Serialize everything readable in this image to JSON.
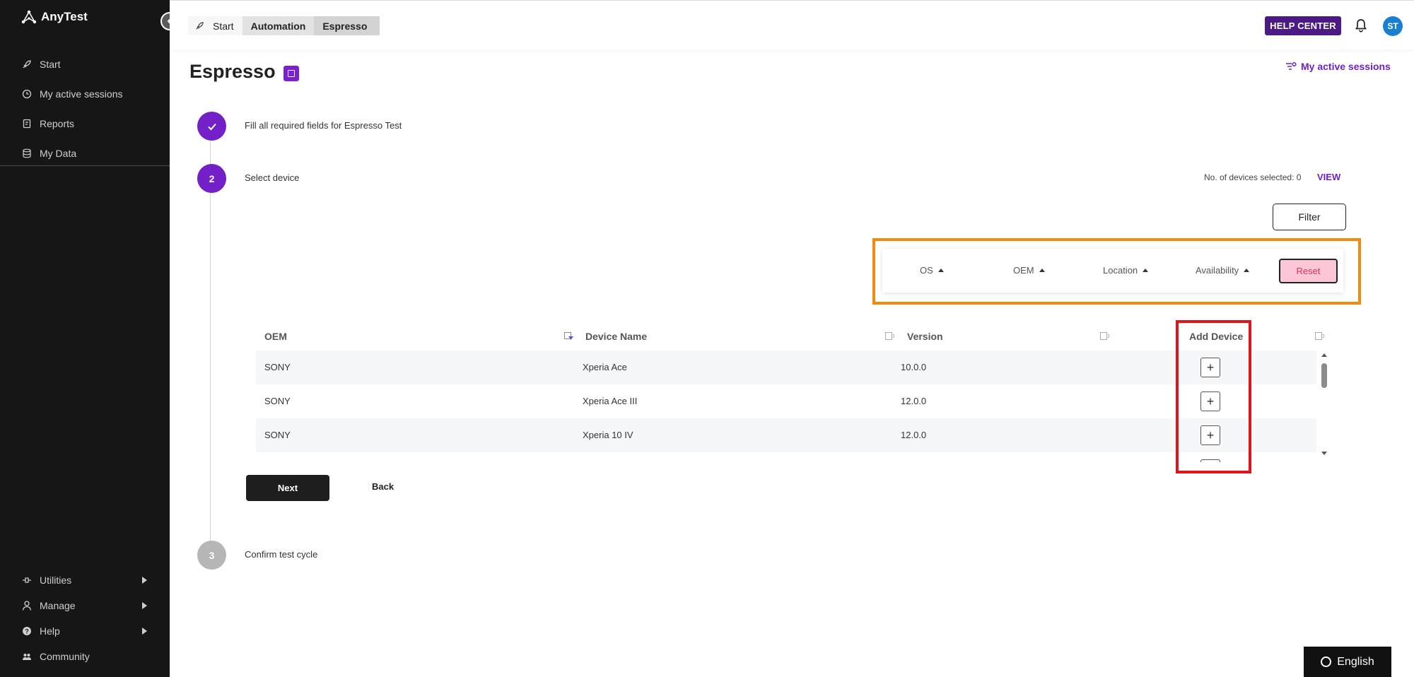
{
  "app": {
    "name": "AnyTest"
  },
  "sidebar": {
    "top_items": [
      {
        "label": "Start",
        "icon": "rocket-icon"
      },
      {
        "label": "My active sessions",
        "icon": "clock-icon"
      },
      {
        "label": "Reports",
        "icon": "report-icon"
      },
      {
        "label": "My Data",
        "icon": "database-icon"
      }
    ],
    "bottom_items": [
      {
        "label": "Utilities",
        "icon": "utilities-icon"
      },
      {
        "label": "Manage",
        "icon": "user-icon"
      },
      {
        "label": "Help",
        "icon": "help-icon"
      },
      {
        "label": "Community",
        "icon": "community-icon"
      }
    ]
  },
  "topbar": {
    "breadcrumb": [
      "Start",
      "Automation",
      "Espresso"
    ],
    "help_center": "HELP CENTER",
    "avatar_initials": "ST"
  },
  "page": {
    "title": "Espresso",
    "active_sessions_link": "My active sessions"
  },
  "steps": [
    {
      "number": "",
      "label": "Fill all required fields for Espresso Test",
      "state": "done"
    },
    {
      "number": "2",
      "label": "Select device",
      "state": "active"
    },
    {
      "number": "3",
      "label": "Confirm test cycle",
      "state": "pending"
    }
  ],
  "devices": {
    "selected_text": "No. of devices selected: 0",
    "view_label": "VIEW",
    "filter_label": "Filter",
    "filters": [
      "OS",
      "OEM",
      "Location",
      "Availability"
    ],
    "reset_label": "Reset"
  },
  "table": {
    "columns": [
      "OEM",
      "Device Name",
      "Version",
      "Add Device"
    ],
    "rows": [
      {
        "oem": "SONY",
        "device": "Xperia Ace",
        "version": "10.0.0",
        "add": "+"
      },
      {
        "oem": "SONY",
        "device": "Xperia Ace III",
        "version": "12.0.0",
        "add": "+"
      },
      {
        "oem": "SONY",
        "device": "Xperia 10 IV",
        "version": "12.0.0",
        "add": "+"
      }
    ]
  },
  "actions": {
    "next": "Next",
    "back": "Back"
  },
  "language": {
    "label": "English"
  },
  "colors": {
    "sidebar_bg": "#161616",
    "accent_purple": "#7420c9",
    "help_center_bg": "#4b1a85",
    "highlight_orange": "#f5890f",
    "highlight_red": "#e0141b",
    "reset_bg": "#fbc6d6"
  }
}
